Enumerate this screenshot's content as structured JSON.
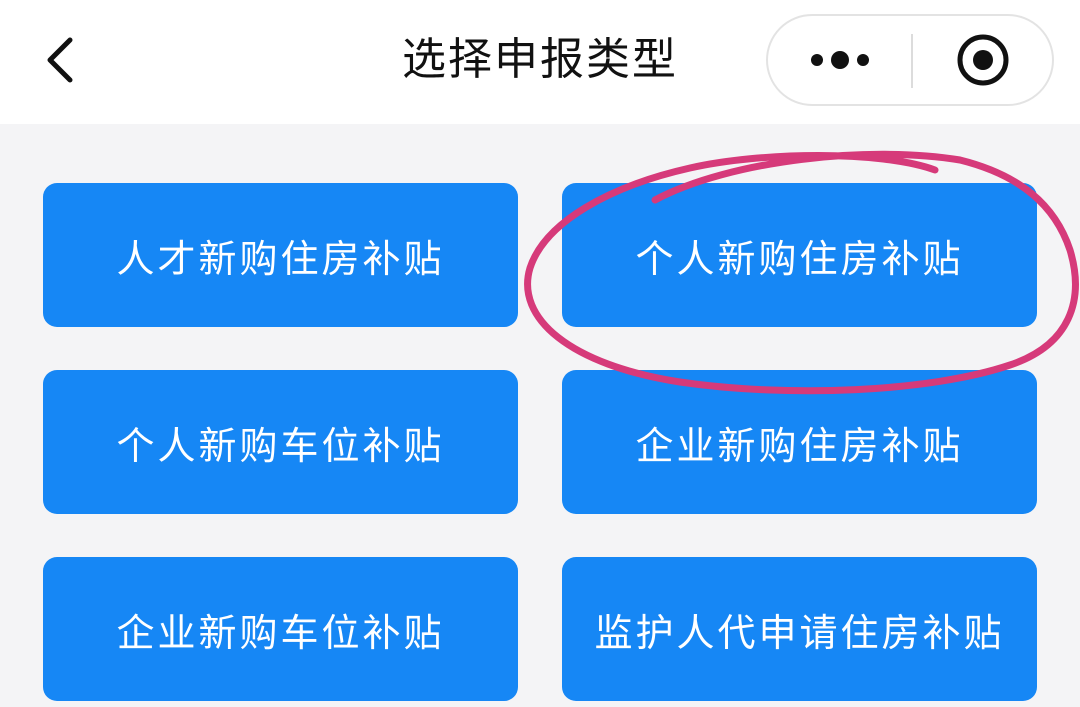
{
  "header": {
    "title": "选择申报类型"
  },
  "buttons": [
    {
      "label": "人才新购住房补贴"
    },
    {
      "label": "个人新购住房补贴"
    },
    {
      "label": "个人新购车位补贴"
    },
    {
      "label": "企业新购住房补贴"
    },
    {
      "label": "企业新购车位补贴"
    },
    {
      "label": "监护人代申请住房补贴"
    }
  ],
  "colors": {
    "button_bg": "#1687f5",
    "page_bg": "#f4f4f6",
    "annotation_stroke": "#d63a7a"
  },
  "icons": {
    "back": "chevron-left-icon",
    "more": "more-dots-icon",
    "close": "target-circle-icon"
  }
}
